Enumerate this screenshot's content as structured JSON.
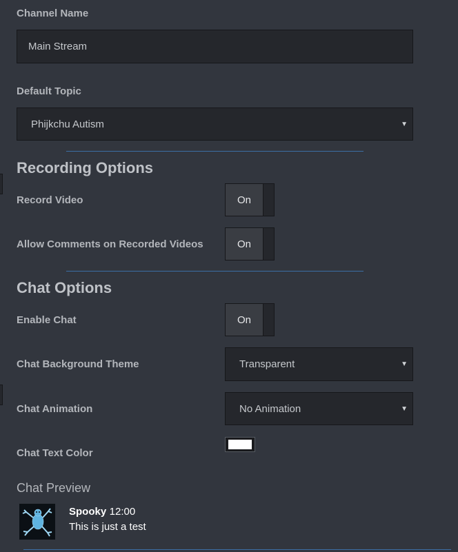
{
  "channel": {
    "label": "Channel Name",
    "value": "Main Stream"
  },
  "topic": {
    "label": "Default Topic",
    "selected": "Phijkchu Autism"
  },
  "recording": {
    "title": "Recording Options",
    "record_video": {
      "label": "Record Video",
      "state": "On"
    },
    "allow_comments": {
      "label": "Allow Comments on Recorded Videos",
      "state": "On"
    }
  },
  "chat": {
    "title": "Chat Options",
    "enable": {
      "label": "Enable Chat",
      "state": "On"
    },
    "background_theme": {
      "label": "Chat Background Theme",
      "selected": "Transparent"
    },
    "animation": {
      "label": "Chat Animation",
      "selected": "No Animation"
    },
    "text_color": {
      "label": "Chat Text Color",
      "value": "#ffffff"
    }
  },
  "preview": {
    "title": "Chat Preview",
    "avatar_icon": "frog-avatar-icon",
    "username": "Spooky",
    "time": "12:00",
    "message": "This is just a test"
  },
  "colors": {
    "background": "#32363e",
    "field": "#25272c",
    "divider": "#3c6fa6"
  }
}
